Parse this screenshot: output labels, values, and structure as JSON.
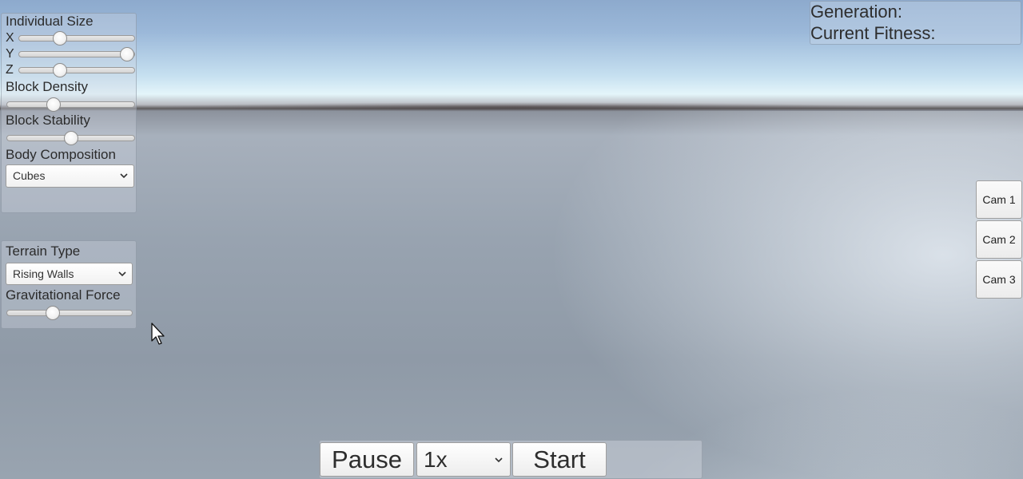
{
  "creature_panel": {
    "individual_size_label": "Individual Size",
    "axes": [
      {
        "label": "X",
        "value": 0.33
      },
      {
        "label": "Y",
        "value": 1.0
      },
      {
        "label": "Z",
        "value": 0.33
      }
    ],
    "block_density": {
      "label": "Block Density",
      "value": 0.35
    },
    "block_stability": {
      "label": "Block Stability",
      "value": 0.5
    },
    "body_composition": {
      "label": "Body Composition",
      "selected": "Cubes"
    }
  },
  "world_panel": {
    "terrain_type": {
      "label": "Terrain Type",
      "selected": "Rising Walls"
    },
    "gravitational_force": {
      "label": "Gravitational Force",
      "value": 0.35
    }
  },
  "info": {
    "generation_label": "Generation:",
    "fitness_label": "Current Fitness:"
  },
  "cameras": [
    "Cam 1",
    "Cam 2",
    "Cam 3"
  ],
  "controls": {
    "pause_label": "Pause",
    "speed_selected": "1x",
    "start_label": "Start"
  },
  "icons": {
    "dropdown": "chevron-down-icon",
    "cursor": "mouse-pointer-icon"
  }
}
